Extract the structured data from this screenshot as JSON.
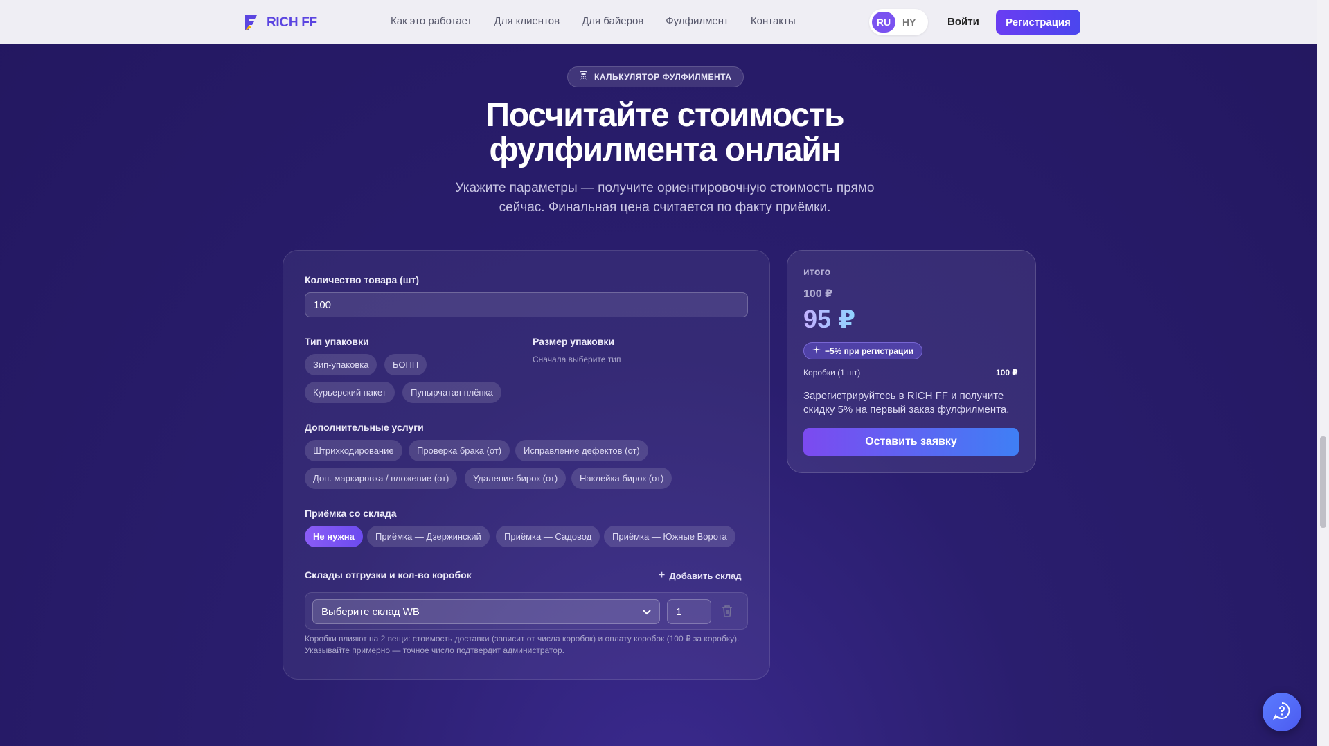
{
  "brand": {
    "name": "RICH FF"
  },
  "nav": [
    "Как это работает",
    "Для клиентов",
    "Для байеров",
    "Фулфилмент",
    "Контакты"
  ],
  "lang": {
    "active": "RU",
    "other": "HY"
  },
  "auth": {
    "login": "Войти",
    "signup": "Регистрация"
  },
  "hero": {
    "tag": "КАЛЬКУЛЯТОР ФУЛФИЛМЕНТА",
    "title_line1": "Посчитайте стоимость",
    "title_line2": "фулфилмента онлайн",
    "subtitle_line1": "Укажите параметры — получите ориентировочную стоимость прямо",
    "subtitle_line2": "сейчас. Финальная цена считается по факту приёмки."
  },
  "calc": {
    "qty_label": "Количество товара (шт)",
    "qty_value": "100",
    "pack_type_label": "Тип упаковки",
    "pack_types": [
      "Зип-упаковка",
      "БОПП",
      "Курьерский пакет",
      "Пупырчатая плёнка"
    ],
    "pack_size_label": "Размер упаковки",
    "pack_size_hint": "Сначала выберите тип",
    "extra_label": "Дополнительные услуги",
    "extras": [
      "Штрихкодирование",
      "Проверка брака (от)",
      "Исправление дефектов (от)",
      "Доп. маркировка / вложение (от)",
      "Удаление бирок (от)",
      "Наклейка бирок (от)"
    ],
    "pickup_label": "Приёмка со склада",
    "pickups": [
      "Не нужна",
      "Приёмка — Дзержинский",
      "Приёмка — Садовод",
      "Приёмка — Южные Ворота"
    ],
    "warehouses_label": "Склады отгрузки и кол-во коробок",
    "add_warehouse": "Добавить склад",
    "select_placeholder": "Выберите склад WB",
    "boxes_value": "1",
    "note": "Коробки влияют на 2 вещи: стоимость доставки (зависит от числа коробок) и оплату коробок (100 ₽ за коробку). Указывайте примерно — точное число подтвердит администратор."
  },
  "summary": {
    "label": "итого",
    "old_price": "100 ₽",
    "new_price": "95 ₽",
    "discount": "−5% при регистрации",
    "boxes_label": "Коробки (1 шт)",
    "boxes_price": "100 ₽",
    "promo": "Зарегистрируйтесь в RICH FF и получите скидку 5% на первый заказ фулфилмента.",
    "cta": "Оставить заявку"
  },
  "colors": {
    "accent": "#6a3df2",
    "bg": "#2a1e6e",
    "header": "#efeef4"
  }
}
